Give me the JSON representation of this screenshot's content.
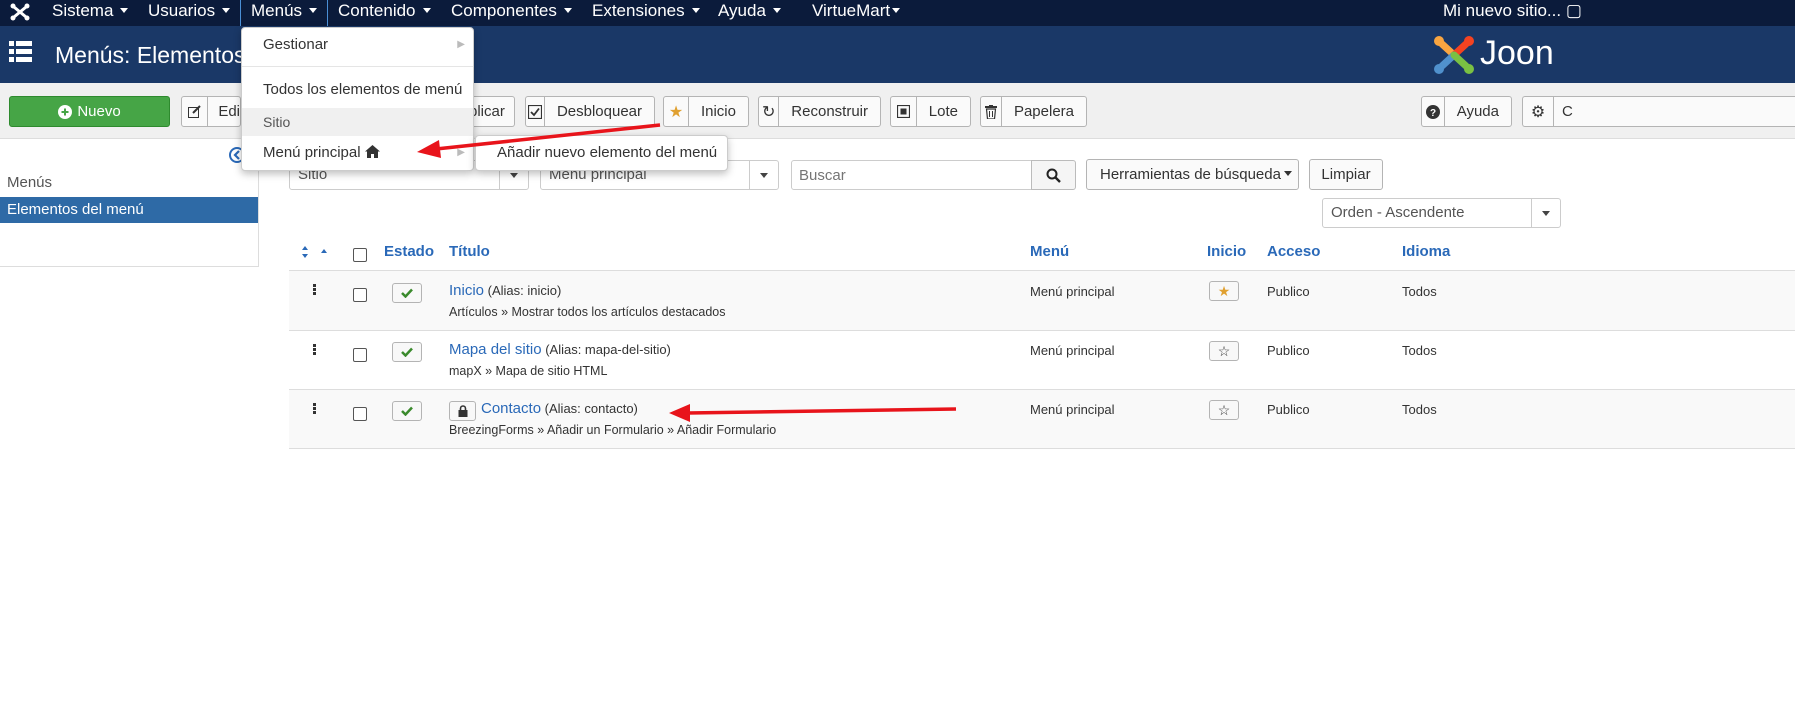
{
  "colors": {
    "navbar": "#0b1b3b",
    "titlebar": "#1a3867",
    "accent": "#2a69b8",
    "new_button": "#46a546",
    "annotation_arrow": "#e8141b",
    "checkmark": "#3a8a2c",
    "star_home": "#e0a030"
  },
  "nav": {
    "items": [
      {
        "label": "Sistema",
        "icon": "caret-down-icon"
      },
      {
        "label": "Usuarios",
        "icon": "caret-down-icon"
      },
      {
        "label": "Menús",
        "icon": "caret-down-icon",
        "active": true
      },
      {
        "label": "Contenido",
        "icon": "caret-down-icon"
      },
      {
        "label": "Componentes",
        "icon": "caret-down-icon"
      },
      {
        "label": "Extensiones",
        "icon": "caret-down-icon"
      },
      {
        "label": "Ayuda",
        "icon": "caret-down-icon"
      },
      {
        "label": "VirtueMart",
        "icon": "caret-down-icon"
      }
    ],
    "site_name": "Mi nuevo sitio..."
  },
  "header": {
    "title": "Menús: Elementos (",
    "brand": "Joon"
  },
  "menus_dropdown": {
    "manage": "Gestionar",
    "all_items": "Todos los elementos de menú",
    "section": "Sitio",
    "main_menu": "Menú principal",
    "submenu_item": "Añadir nuevo elemento del menú"
  },
  "toolbar": {
    "new": "Nuevo",
    "edit": "Edi",
    "duplicate": "plicar",
    "unlock": "Desbloquear",
    "home": "Inicio",
    "rebuild": "Reconstruir",
    "batch": "Lote",
    "trash": "Papelera",
    "help": "Ayuda",
    "options": "C"
  },
  "sidebar": {
    "title": "Menús",
    "active_item": "Elementos del menú"
  },
  "filters": {
    "site": "Sitio",
    "menu": "Menú principal",
    "search_placeholder": "Buscar",
    "tools": "Herramientas de búsqueda",
    "clear": "Limpiar",
    "order": "Orden - Ascendente"
  },
  "table": {
    "headers": {
      "estado": "Estado",
      "titulo": "Título",
      "menu": "Menú",
      "inicio": "Inicio",
      "acceso": "Acceso",
      "idioma": "Idioma"
    },
    "rows": [
      {
        "title": "Inicio",
        "alias": "(Alias: inicio)",
        "type": "Artículos » Mostrar todos los artículos destacados",
        "menu": "Menú principal",
        "home": true,
        "access": "Publico",
        "language": "Todos",
        "locked": false
      },
      {
        "title": "Mapa del sitio",
        "alias": "(Alias: mapa-del-sitio)",
        "type": "mapX » Mapa de sitio HTML",
        "menu": "Menú principal",
        "home": false,
        "access": "Publico",
        "language": "Todos",
        "locked": false
      },
      {
        "title": "Contacto",
        "alias": "(Alias: contacto)",
        "type": "BreezingForms » Añadir un Formulario » Añadir Formulario",
        "menu": "Menú principal",
        "home": false,
        "access": "Publico",
        "language": "Todos",
        "locked": true
      }
    ]
  }
}
